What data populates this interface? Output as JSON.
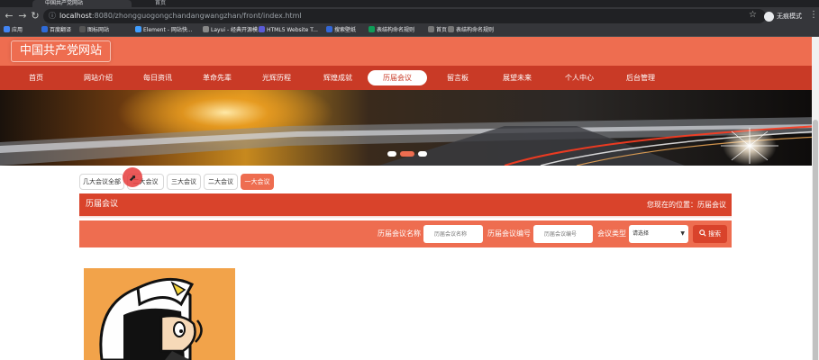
{
  "browser": {
    "tabs": [
      {
        "title": "中国共产党网站",
        "active": true
      },
      {
        "title": "首页",
        "active": false
      }
    ],
    "url_host": "localhost",
    "url_path": ":8080/zhongguogongchandangwangzhan/front/index.html",
    "profile_label": "无痕模式",
    "bookmarks": [
      {
        "label": "应用",
        "color": "#4285f4"
      },
      {
        "label": "百度翻译",
        "color": "#2f6bd8"
      },
      {
        "label": "图标网站",
        "color": "#555555"
      },
      {
        "label": "Element - 网站快...",
        "color": "#409eff"
      },
      {
        "label": "Layui - 经典开源模...",
        "color": "#888888"
      },
      {
        "label": "HTML5 Website T...",
        "color": "#5b5bd6"
      },
      {
        "label": "搜索壁纸",
        "color": "#3367d6"
      },
      {
        "label": "表结构命名规则",
        "color": "#0f9d58"
      },
      {
        "label": "首页",
        "color": "#777777"
      },
      {
        "label": "表结构命名规则",
        "color": "#777777"
      }
    ]
  },
  "site": {
    "logo": "中国共产党网站",
    "nav": [
      {
        "label": "首页",
        "active": false
      },
      {
        "label": "网站介绍",
        "active": false
      },
      {
        "label": "每日资讯",
        "active": false
      },
      {
        "label": "革命先辈",
        "active": false
      },
      {
        "label": "光辉历程",
        "active": false
      },
      {
        "label": "辉煌成就",
        "active": false
      },
      {
        "label": "历届会议",
        "active": true
      },
      {
        "label": "留言板",
        "active": false
      },
      {
        "label": "展望未来",
        "active": false
      },
      {
        "label": "个人中心",
        "active": false
      },
      {
        "label": "后台管理",
        "active": false
      }
    ]
  },
  "banner": {
    "dot_count": 3,
    "active_dot": 1
  },
  "categories": [
    {
      "label": "几大会议全部",
      "active": false
    },
    {
      "label": "二大会议",
      "active": false
    },
    {
      "label": "三大会议",
      "active": false
    },
    {
      "label": "二大会议",
      "active": false
    },
    {
      "label": "一大会议",
      "active": true
    }
  ],
  "section": {
    "title": "历届会议",
    "location_prefix": "您现在的位置：",
    "location": "历届会议"
  },
  "search": {
    "name_label": "历届会议名称",
    "name_placeholder": "历届会议名称",
    "number_label": "历届会议编号",
    "number_placeholder": "历届会议编号",
    "type_label": "会议类型",
    "type_value": "请选择",
    "button_label": "搜索",
    "button_icon": "search-icon"
  },
  "colors": {
    "header": "#ee6d50",
    "nav": "#c93a26",
    "accent": "#d9432b"
  }
}
